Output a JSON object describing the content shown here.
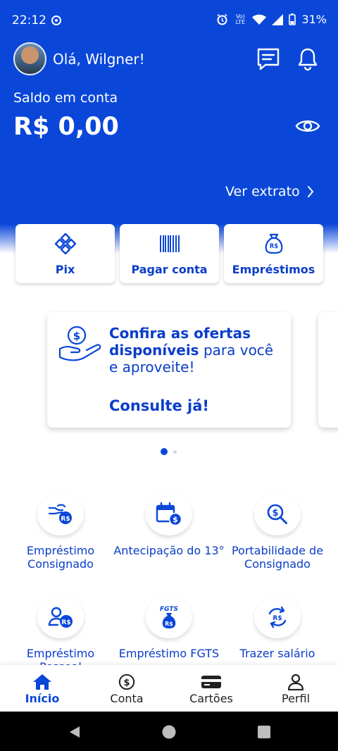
{
  "status_bar": {
    "time": "22:12",
    "network_label": "Vo) LTE",
    "battery": "31%"
  },
  "header": {
    "greeting": "Olá, Wilgner!",
    "balance_label": "Saldo em conta",
    "balance_value": "R$ 0,00",
    "statement_link": "Ver extrato"
  },
  "quick_actions": [
    {
      "label": "Pix",
      "icon": "pix-icon"
    },
    {
      "label": "Pagar conta",
      "icon": "barcode-icon"
    },
    {
      "label": "Empréstimos",
      "icon": "money-bag-icon"
    }
  ],
  "banner": {
    "text_bold": "Confira as ofertas disponíveis",
    "text_regular": " para você e aproveite!",
    "cta": "Consulte já!",
    "page_count": 2,
    "active_page": 1
  },
  "services": [
    {
      "label": "Empréstimo Consignado",
      "icon": "hand-money-icon"
    },
    {
      "label": "Antecipação do 13°",
      "icon": "calendar-money-icon"
    },
    {
      "label": "Portabilidade de Consignado",
      "icon": "search-money-icon"
    },
    {
      "label": "Empréstimo Pessoal",
      "icon": "person-money-icon"
    },
    {
      "label": "Empréstimo FGTS",
      "icon": "fgts-bag-icon"
    },
    {
      "label": "Trazer salário",
      "icon": "transfer-money-icon"
    }
  ],
  "tabs": [
    {
      "label": "Início",
      "icon": "home-icon",
      "active": true
    },
    {
      "label": "Conta",
      "icon": "dollar-circle-icon",
      "active": false
    },
    {
      "label": "Cartões",
      "icon": "card-icon",
      "active": false
    },
    {
      "label": "Perfil",
      "icon": "person-icon",
      "active": false
    }
  ],
  "colors": {
    "primary": "#0a47d9",
    "text_blue": "#0a3dc9",
    "white": "#ffffff"
  }
}
